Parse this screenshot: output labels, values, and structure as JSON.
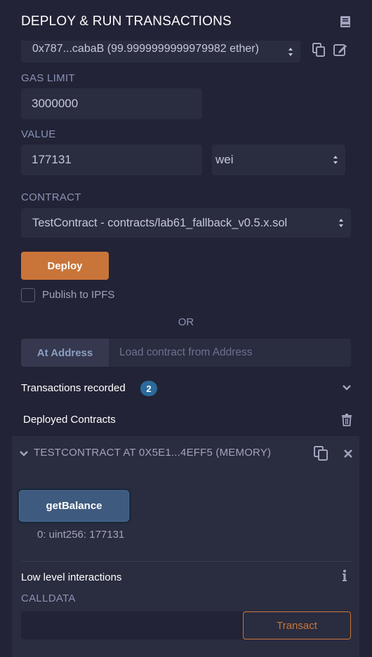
{
  "header": {
    "title": "DEPLOY & RUN TRANSACTIONS",
    "book_icon": "book-icon"
  },
  "account": {
    "value": "0x787...cabaB (99.9999999999979982 ether)"
  },
  "gas_limit": {
    "label": "GAS LIMIT",
    "value": "3000000"
  },
  "value": {
    "label": "VALUE",
    "amount": "177131",
    "unit": "wei"
  },
  "contract": {
    "label": "CONTRACT",
    "selected": "TestContract - contracts/lab61_fallback_v0.5.x.sol"
  },
  "deploy": {
    "label": "Deploy"
  },
  "publish": {
    "label": "Publish to IPFS",
    "checked": false
  },
  "or_text": "OR",
  "at_address": {
    "button_label": "At Address",
    "placeholder": "Load contract from Address"
  },
  "transactions": {
    "label": "Transactions recorded",
    "count": "2"
  },
  "deployed": {
    "title": "Deployed Contracts",
    "instance": {
      "title": "TESTCONTRACT AT 0X5E1...4EFF5 (MEMORY)",
      "function_button": "getBalance",
      "result": "0: uint256: 177131"
    }
  },
  "low_level": {
    "title": "Low level interactions",
    "calldata_label": "CALLDATA",
    "transact_label": "Transact"
  },
  "colors": {
    "accent": "#c97539",
    "background": "#222336",
    "panel": "#2a2c3f",
    "badge": "#2b6a9b"
  }
}
